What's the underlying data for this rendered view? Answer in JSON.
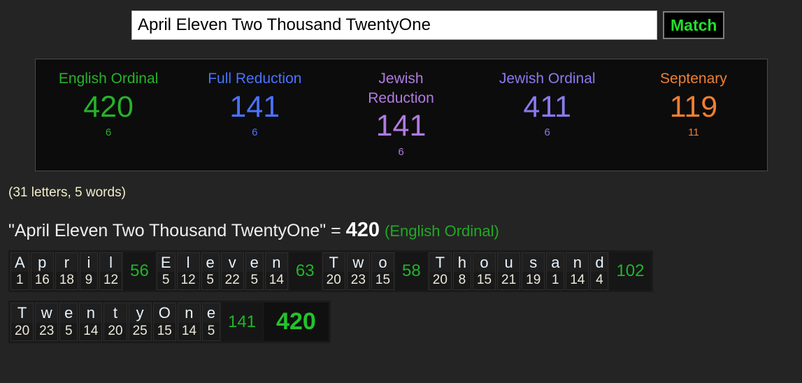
{
  "search": {
    "value": "April Eleven Two Thousand TwentyOne",
    "placeholder": "",
    "match_label": "Match"
  },
  "ciphers": [
    {
      "name": "English Ordinal",
      "value": "420",
      "reduced": "6",
      "color": "#25b32a"
    },
    {
      "name": "Full Reduction",
      "value": "141",
      "reduced": "6",
      "color": "#4a72ff"
    },
    {
      "name": "Jewish\nReduction",
      "value": "141",
      "reduced": "6",
      "color": "#b07be0"
    },
    {
      "name": "Jewish Ordinal",
      "value": "411",
      "reduced": "6",
      "color": "#8a7aef"
    },
    {
      "name": "Septenary",
      "value": "119",
      "reduced": "11",
      "color": "#ef7f33"
    }
  ],
  "counts_text": "(31 letters, 5 words)",
  "headline": {
    "phrase": "\"April Eleven Two Thousand TwentyOne\"",
    "equals": "=",
    "total": "420",
    "cipher_label": "(English Ordinal)"
  },
  "breakdown": {
    "grand_total": "420",
    "rows": [
      {
        "words": [
          {
            "word": "April",
            "letters": [
              "A",
              "p",
              "r",
              "i",
              "l"
            ],
            "values": [
              "1",
              "16",
              "18",
              "9",
              "12"
            ],
            "sum": "56"
          },
          {
            "word": "Eleven",
            "letters": [
              "E",
              "l",
              "e",
              "v",
              "e",
              "n"
            ],
            "values": [
              "5",
              "12",
              "5",
              "22",
              "5",
              "14"
            ],
            "sum": "63"
          },
          {
            "word": "Two",
            "letters": [
              "T",
              "w",
              "o"
            ],
            "values": [
              "20",
              "23",
              "15"
            ],
            "sum": "58"
          },
          {
            "word": "Thousand",
            "letters": [
              "T",
              "h",
              "o",
              "u",
              "s",
              "a",
              "n",
              "d"
            ],
            "values": [
              "20",
              "8",
              "15",
              "21",
              "19",
              "1",
              "14",
              "4"
            ],
            "sum": "102"
          }
        ],
        "has_grand_total": false
      },
      {
        "words": [
          {
            "word": "TwentyOne",
            "letters": [
              "T",
              "w",
              "e",
              "n",
              "t",
              "y",
              "O",
              "n",
              "e"
            ],
            "values": [
              "20",
              "23",
              "5",
              "14",
              "20",
              "25",
              "15",
              "14",
              "5"
            ],
            "sum": "141"
          }
        ],
        "has_grand_total": true
      }
    ]
  }
}
